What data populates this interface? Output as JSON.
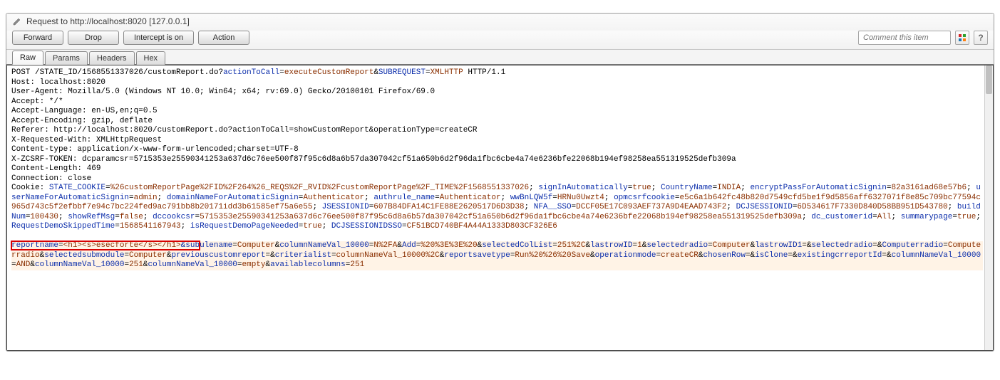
{
  "titleBar": {
    "label": "Request to http://localhost:8020  [127.0.0.1]"
  },
  "toolbar": {
    "forward": "Forward",
    "drop": "Drop",
    "intercept": "Intercept is on",
    "action": "Action",
    "commentPlaceholder": "Comment this item",
    "help": "?"
  },
  "tabs": {
    "raw": "Raw",
    "params": "Params",
    "headers": "Headers",
    "hex": "Hex"
  },
  "request": {
    "method": "POST",
    "path": "/STATE_ID/1568551337026/customReport.do",
    "httpVersion": "HTTP/1.1",
    "queryParams": [
      {
        "name": "actionToCall",
        "value": "executeCustomReport"
      },
      {
        "name": "SUBREQUEST",
        "value": "XMLHTTP"
      }
    ],
    "headers": {
      "Host": "localhost:8020",
      "UserAgent": "Mozilla/5.0 (Windows NT 10.0; Win64; x64; rv:69.0) Gecko/20100101 Firefox/69.0",
      "Accept": "*/*",
      "AcceptLanguage": "en-US,en;q=0.5",
      "AcceptEncoding": "gzip, deflate",
      "Referer": "http://localhost:8020/customReport.do?actionToCall=showCustomReport&operationType=createCR",
      "XRequestedWith": "XMLHttpRequest",
      "ContentType": "application/x-www-form-urlencoded;charset=UTF-8",
      "XZCSRFTOKEN": "dcparamcsr=5715353e25590341253a637d6c76ee500f87f95c6d8a6b57da307042cf51a650b6d2f96da1fbc6cbe4a74e6236bfe22068b194ef98258ea551319525defb309a",
      "ContentLength": "469",
      "Connection": "close"
    },
    "cookies": [
      {
        "name": "STATE_COOKIE",
        "value": "%26customReportPage%2FID%2F264%26_REQS%2F_RVID%2FcustomReportPage%2F_TIME%2F1568551337026"
      },
      {
        "name": "signInAutomatically",
        "value": "true"
      },
      {
        "name": "CountryName",
        "value": "INDIA"
      },
      {
        "name": "encryptPassForAutomaticSignin",
        "value": "82a3161ad68e57b6"
      },
      {
        "name": "userNameForAutomaticSignin",
        "value": "admin"
      },
      {
        "name": "domainNameForAutomaticSignin",
        "value": "Authenticator"
      },
      {
        "name": "authrule_name",
        "value": "Authenticator"
      },
      {
        "name": "wwBnLQW5f",
        "value": "HRNu0Uwzt4"
      },
      {
        "name": "opmcsrfcookie",
        "value": "e5c6a1b642fc48b820d7549cfd5be1f9d5856aff6327071f8e85c709bc77594c965d743c5f2efbbf7e94c7bc224fed9ac791bb8b20171idd3b61585ef75a6e55"
      },
      {
        "name": "JSESSIONID",
        "value": "607B84DFA14C1FE88E2620517D6D3D38"
      },
      {
        "name": "NFA__SSO",
        "value": "DCCF05E17C093AEF737A9D4EAAD743F2"
      },
      {
        "name": "DCJSESSIONID",
        "value": "6D534617F7330D840D58BB951D543780"
      },
      {
        "name": "buildNum",
        "value": "100430"
      },
      {
        "name": "showRefMsg",
        "value": "false"
      },
      {
        "name": "dccookcsr",
        "value": "5715353e25590341253a637d6c76ee500f87f95c6d8a6b57da307042cf51a650b6d2f96da1fbc6cbe4a74e6236bfe22068b194ef98258ea551319525defb309a"
      },
      {
        "name": "dc_customerid",
        "value": "All"
      },
      {
        "name": "summarypage",
        "value": "true"
      },
      {
        "name": "RequestDemoSkippedTime",
        "value": "1568541167943"
      },
      {
        "name": "isRequestDemoPageNeeded",
        "value": "true"
      },
      {
        "name": "DCJSESSIONIDSSO",
        "value": "CF51BCD740BF4A44A1333D803CF326E6"
      }
    ],
    "body": {
      "highlighted": {
        "name": "reportname",
        "value": "<h1><s>esecforte</s></h1>"
      },
      "params": [
        {
          "name": "modulename",
          "value": "Computer"
        },
        {
          "name": "columnNameVal_10000",
          "value": "N%2FA"
        },
        {
          "name": "Add",
          "value": "%20%3E%3E%20"
        },
        {
          "name": "selectedColList",
          "value": "251%2C"
        },
        {
          "name": "lastrowID",
          "value": "1"
        },
        {
          "name": "selectedradio",
          "value": "Computer"
        },
        {
          "name": "lastrowID1",
          "value": ""
        },
        {
          "name": "selectedradio",
          "value": ""
        },
        {
          "name": "Computerradio",
          "value": "Computerradio"
        },
        {
          "name": "selectedsubmodule",
          "value": "Computer"
        },
        {
          "name": "previouscustomreport",
          "value": ""
        },
        {
          "name": "criterialist",
          "value": "columnNameVal_10000%2C"
        },
        {
          "name": "reportsavetype",
          "value": "Run%20%26%20Save"
        },
        {
          "name": "operationmode",
          "value": "createCR"
        },
        {
          "name": "chosenRow",
          "value": ""
        },
        {
          "name": "isClone",
          "value": ""
        },
        {
          "name": "existingcrreportId",
          "value": ""
        },
        {
          "name": "columnNameVal_10000",
          "value": "AND"
        },
        {
          "name": "columnNameVal_10000",
          "value": "251"
        },
        {
          "name": "columnNameVal_10000",
          "value": "empty"
        },
        {
          "name": "availablecolumns",
          "value": "251"
        }
      ]
    }
  }
}
